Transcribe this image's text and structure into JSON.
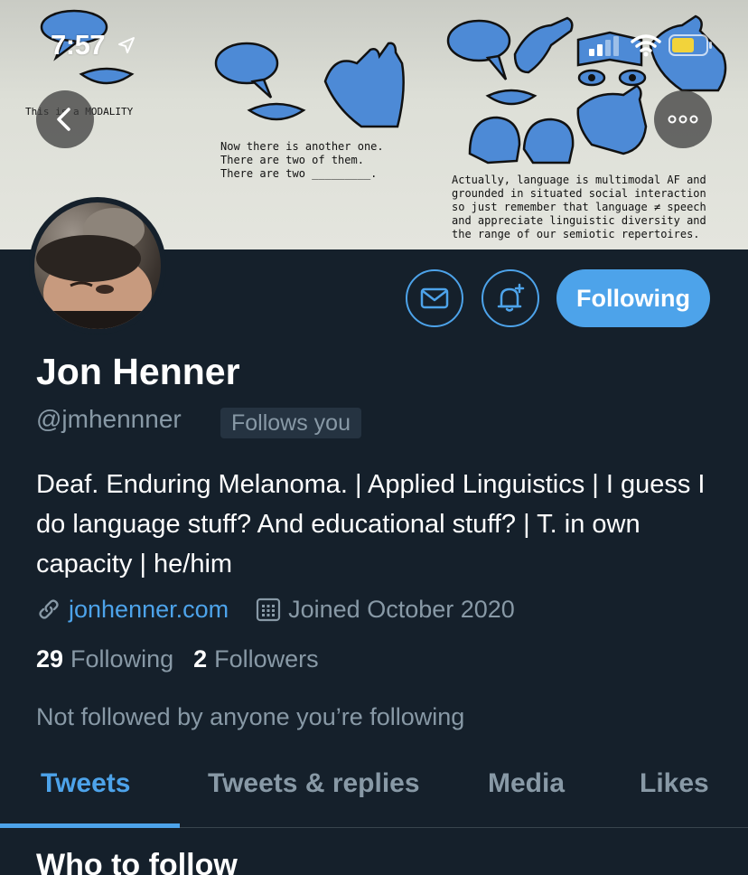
{
  "status_bar": {
    "time": "7:57",
    "icons": [
      "location-arrow-icon",
      "signal-icon",
      "wifi-icon",
      "battery-icon"
    ]
  },
  "banner": {
    "text_left": "This is a MODALITY",
    "text_middle": "Now there is another one.\nThere are two of them.\nThere are two _________.",
    "text_right": "Actually, language is multimodal AF and\ngrounded in situated social interaction\nso just remember that language ≠ speech\nand appreciate linguistic diversity and\nthe range of our semiotic repertoires."
  },
  "nav": {
    "back_icon": "chevron-left-icon",
    "more_icon": "ellipsis-icon"
  },
  "actions": {
    "message_icon": "envelope-icon",
    "notify_icon": "bell-plus-icon",
    "follow_label": "Following"
  },
  "profile": {
    "display_name": "Jon Henner",
    "handle": "@jmhennner",
    "follows_you": "Follows you",
    "bio": "Deaf. Enduring Melanoma. | Applied Linguistics | I guess I do language stuff? And educational stuff? | T. in own capacity | he/him",
    "website": "jonhenner.com",
    "joined": "Joined October 2020",
    "following_count": "29",
    "following_label": "Following",
    "followers_count": "2",
    "followers_label": "Followers",
    "not_followed": "Not followed by anyone you’re following"
  },
  "tabs": [
    {
      "label": "Tweets",
      "active": true
    },
    {
      "label": "Tweets & replies",
      "active": false
    },
    {
      "label": "Media",
      "active": false
    },
    {
      "label": "Likes",
      "active": false
    }
  ],
  "section": {
    "who_to_follow": "Who to follow"
  },
  "colors": {
    "background": "#15202b",
    "accent": "#4da3ea",
    "muted": "#8899a6"
  }
}
